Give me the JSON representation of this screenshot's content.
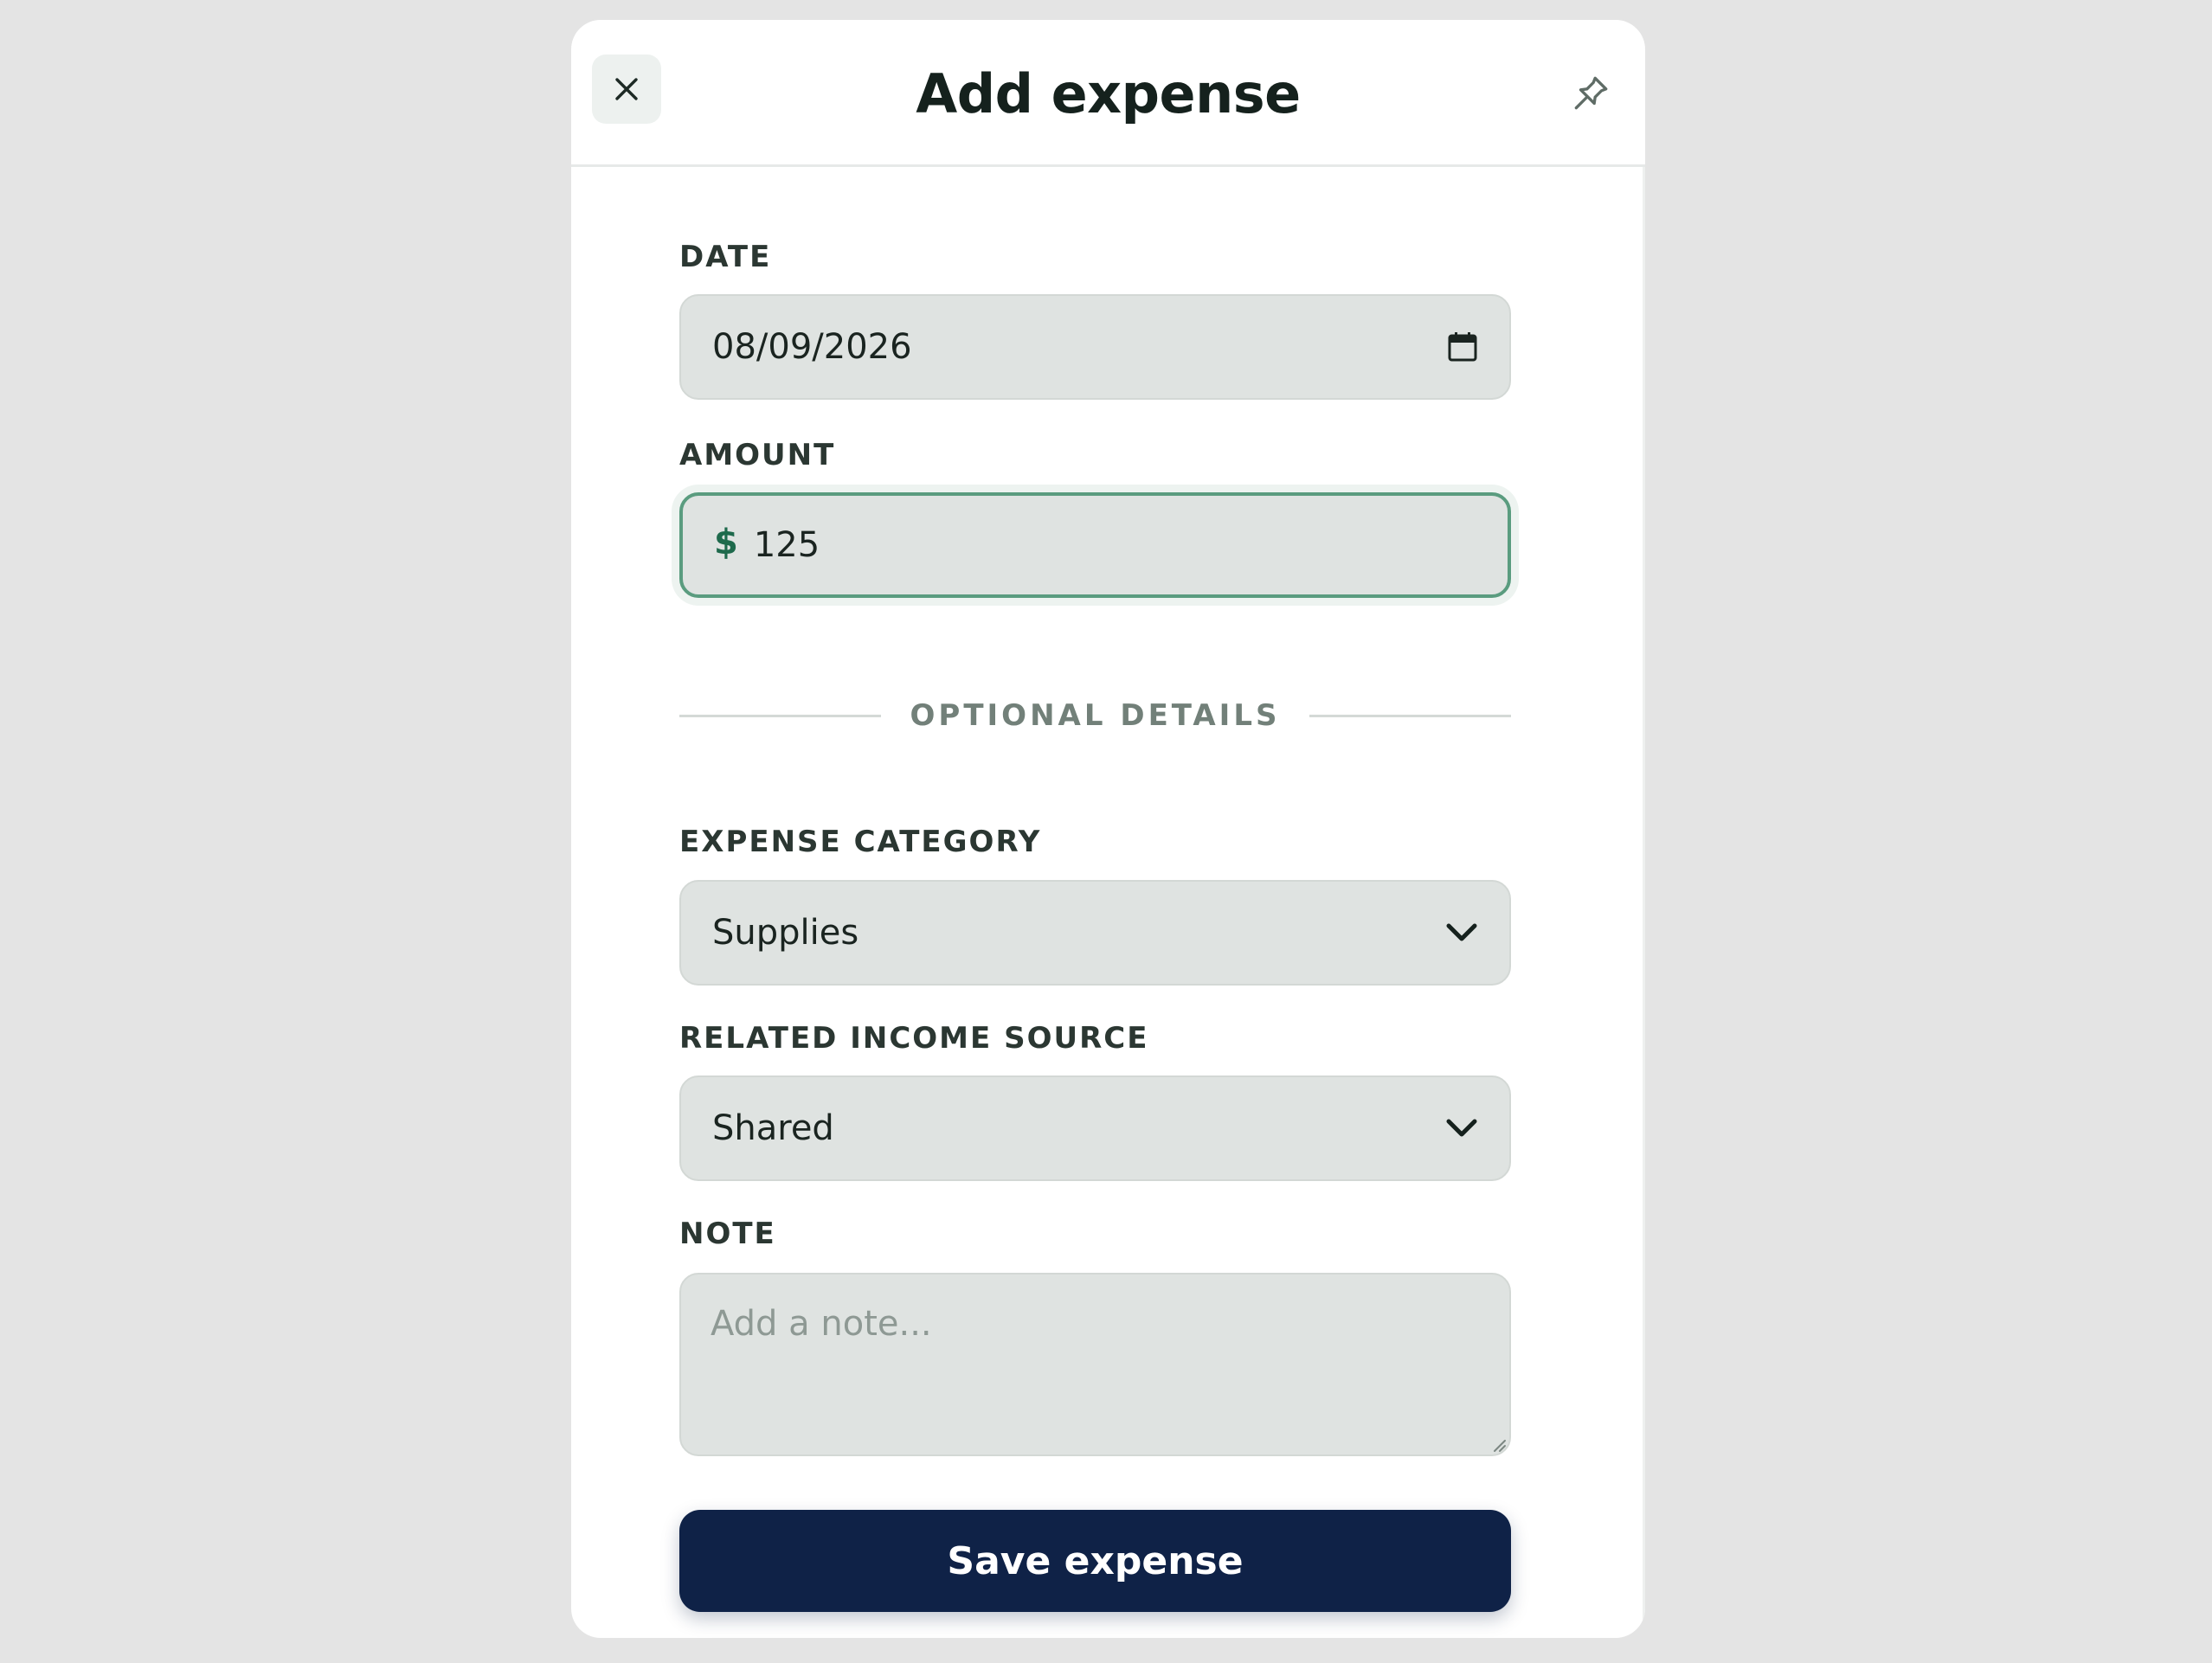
{
  "modal": {
    "title": "Add expense",
    "close_icon": "close-icon",
    "pin_icon": "pin-icon"
  },
  "form": {
    "date": {
      "label": "DATE",
      "value": "08/09/2026",
      "icon": "calendar-icon"
    },
    "amount": {
      "label": "AMOUNT",
      "currency_symbol": "$",
      "value": "125",
      "focused": true
    },
    "optional_divider": "OPTIONAL DETAILS",
    "expense_category": {
      "label": "EXPENSE CATEGORY",
      "selected": "Supplies",
      "icon": "chevron-down-icon"
    },
    "related_income_source": {
      "label": "RELATED INCOME SOURCE",
      "selected": "Shared",
      "icon": "chevron-down-icon"
    },
    "note": {
      "label": "NOTE",
      "placeholder": "Add a note..."
    },
    "save_label": "Save expense"
  },
  "colors": {
    "primary_button": "#0f2247",
    "focus_border": "#5a9c7f",
    "currency_accent": "#1e6a4c",
    "field_background": "#dfe3e1"
  }
}
